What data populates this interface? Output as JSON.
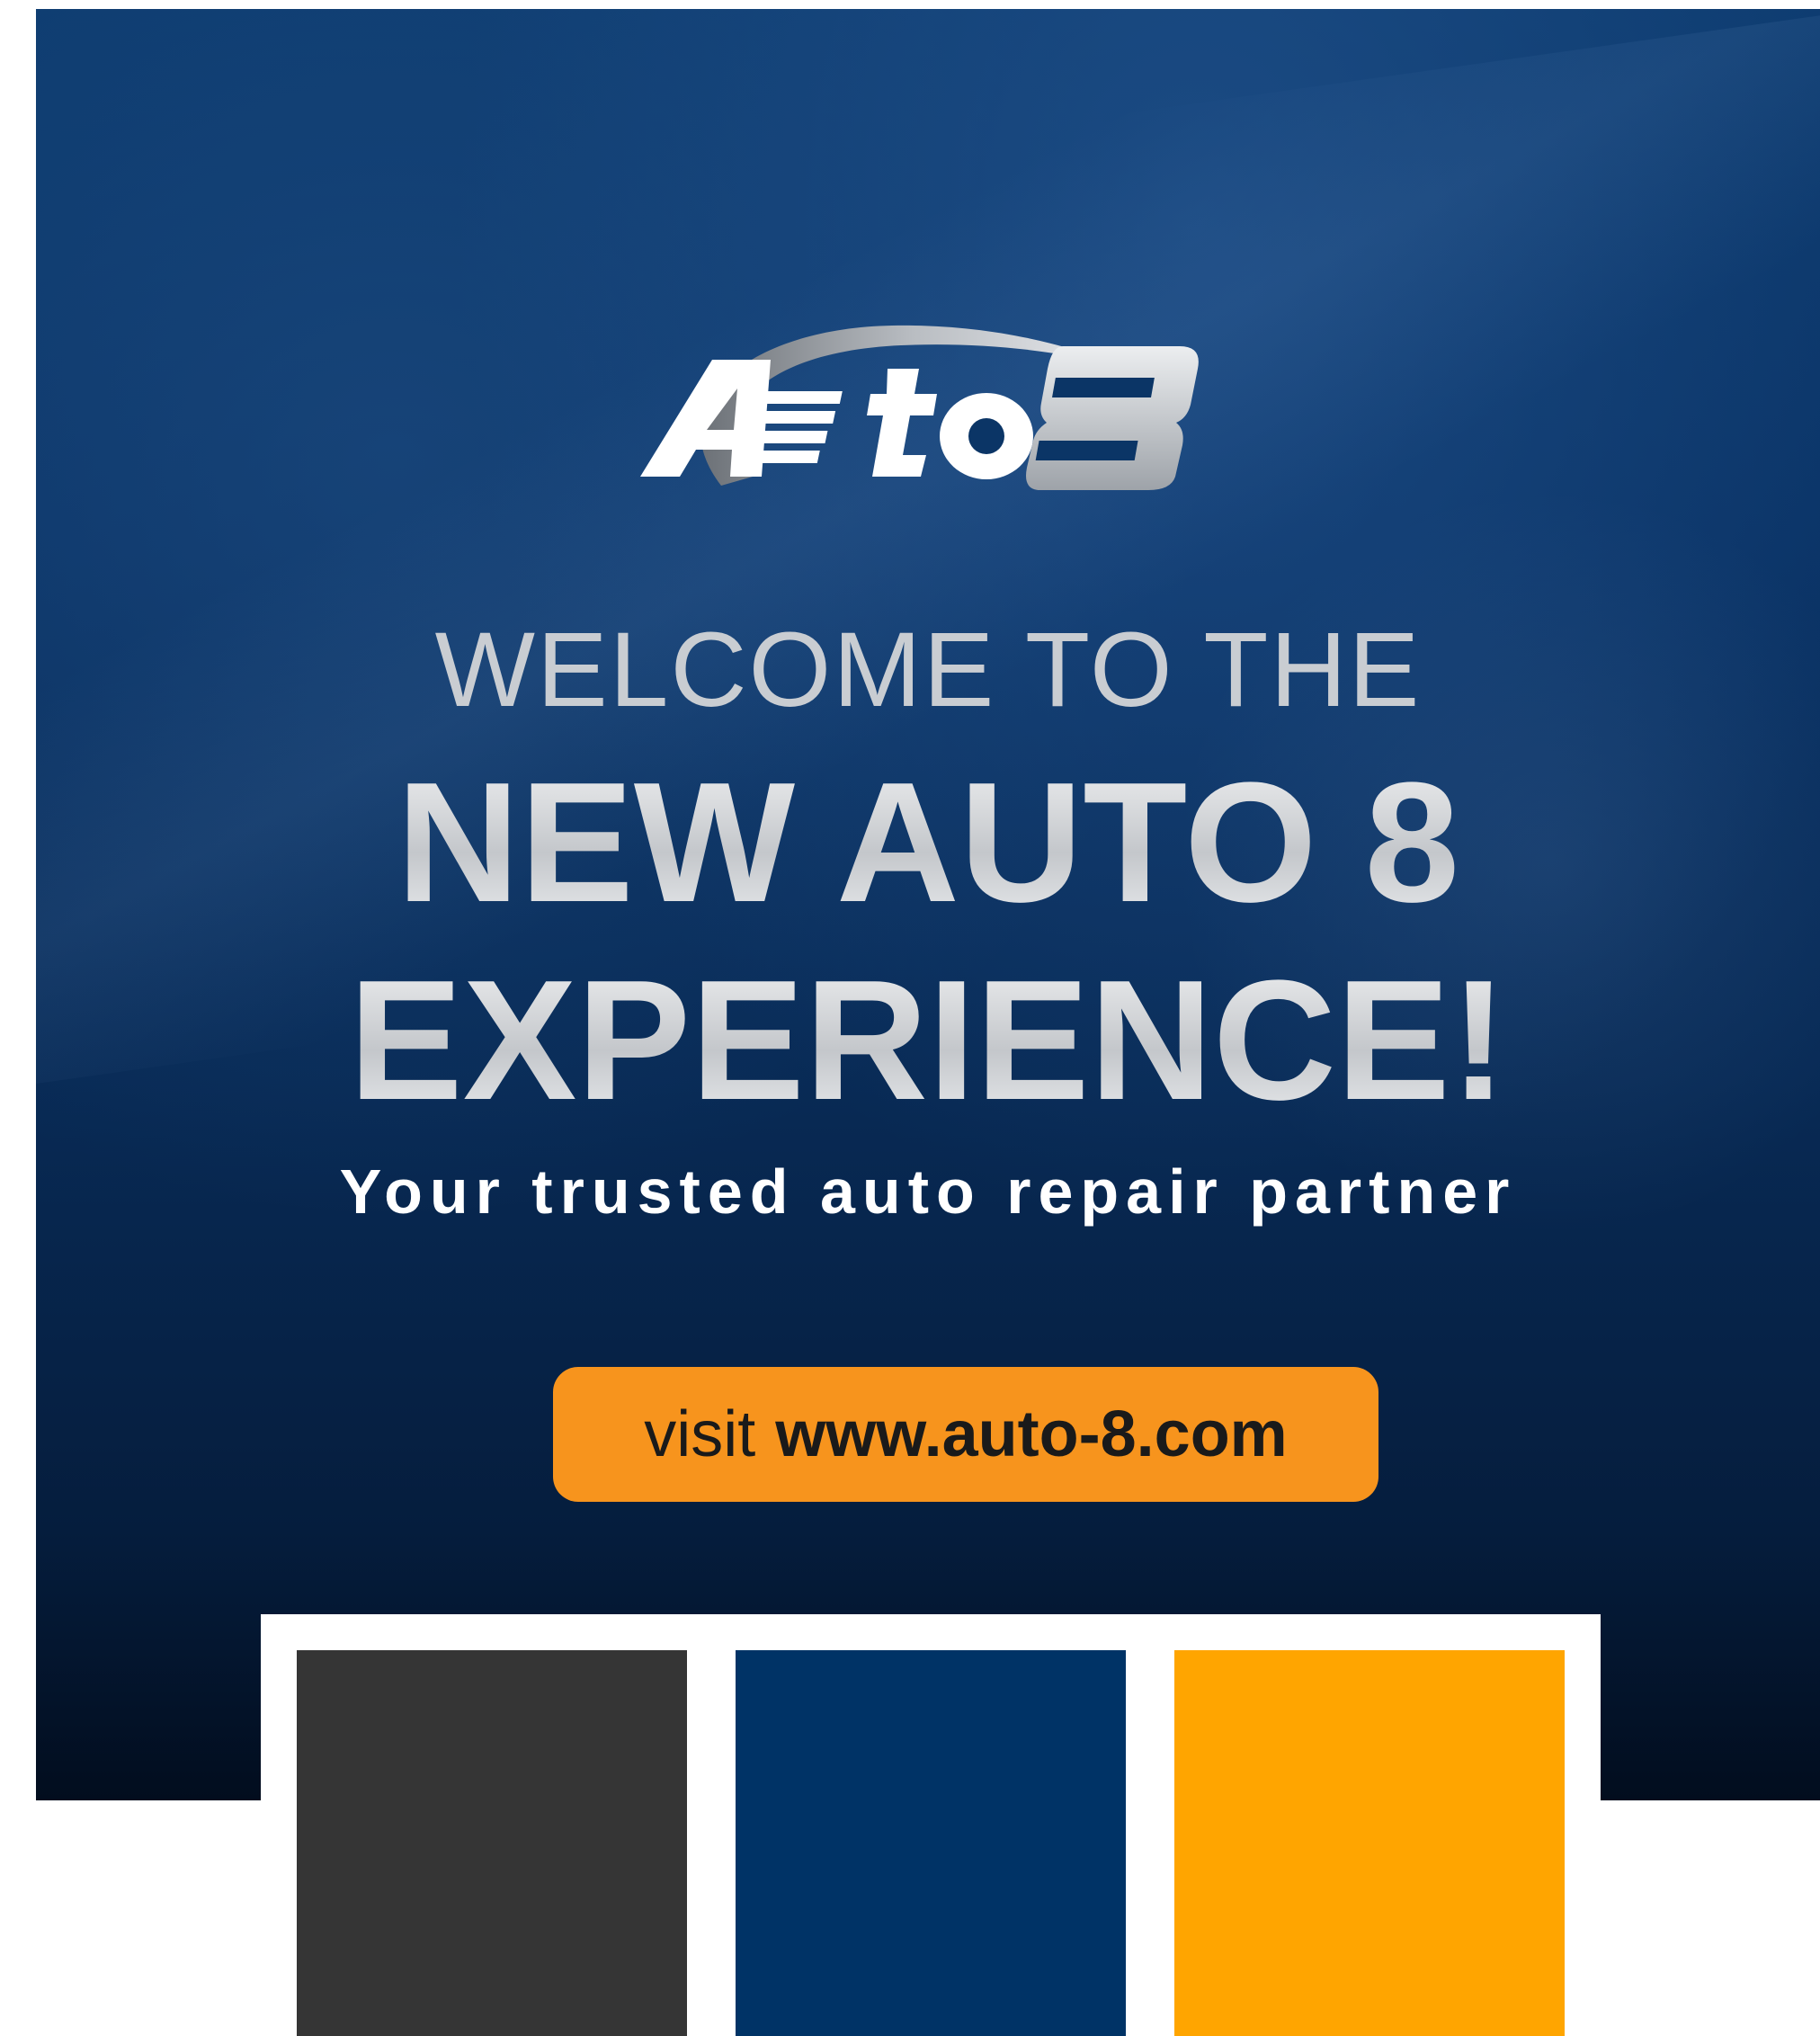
{
  "logo": {
    "text": "Auto8"
  },
  "headline": {
    "welcome": "WELCOME TO THE",
    "line1": "NEW AUTO 8",
    "line2": "EXPERIENCE!",
    "tagline": "Your trusted auto repair partner"
  },
  "cta": {
    "prefix": "visit",
    "url": "www.auto-8.com"
  },
  "colors": {
    "brand_dark_gray": "#353535",
    "brand_navy": "#003366",
    "brand_orange": "#FFA500",
    "cta_button": "#F7941D"
  },
  "palette": [
    {
      "color": "#353535"
    },
    {
      "color": "#003366"
    },
    {
      "color": "#FFA500"
    }
  ]
}
